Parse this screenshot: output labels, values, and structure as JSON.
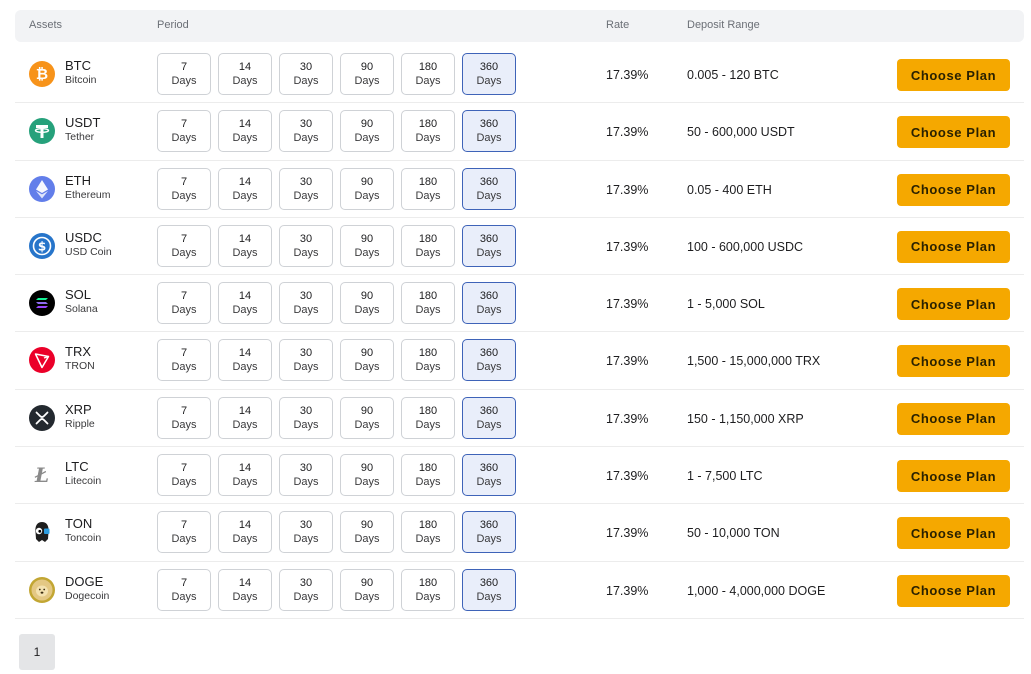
{
  "header": {
    "assets": "Assets",
    "period": "Period",
    "rate": "Rate",
    "deposit_range": "Deposit Range"
  },
  "period_unit": "Days",
  "periods": [
    "7",
    "14",
    "30",
    "90",
    "180",
    "360"
  ],
  "selected_period": "360",
  "choose_label": "Choose Plan",
  "rows": [
    {
      "symbol": "BTC",
      "name": "Bitcoin",
      "rate": "17.39%",
      "range": "0.005 - 120 BTC",
      "icon": "bitcoin-icon",
      "color": "#f7931a"
    },
    {
      "symbol": "USDT",
      "name": "Tether",
      "rate": "17.39%",
      "range": "50 - 600,000 USDT",
      "icon": "tether-icon",
      "color": "#26a17b"
    },
    {
      "symbol": "ETH",
      "name": "Ethereum",
      "rate": "17.39%",
      "range": "0.05 - 400 ETH",
      "icon": "ethereum-icon",
      "color": "#627eea"
    },
    {
      "symbol": "USDC",
      "name": "USD Coin",
      "rate": "17.39%",
      "range": "100 - 600,000 USDC",
      "icon": "usdc-icon",
      "color": "#2775ca"
    },
    {
      "symbol": "SOL",
      "name": "Solana",
      "rate": "17.39%",
      "range": "1 - 5,000 SOL",
      "icon": "solana-icon",
      "color": "#000000"
    },
    {
      "symbol": "TRX",
      "name": "TRON",
      "rate": "17.39%",
      "range": "1,500 - 15,000,000 TRX",
      "icon": "tron-icon",
      "color": "#eb0029"
    },
    {
      "symbol": "XRP",
      "name": "Ripple",
      "rate": "17.39%",
      "range": "150 - 1,150,000 XRP",
      "icon": "xrp-icon",
      "color": "#23292f"
    },
    {
      "symbol": "LTC",
      "name": "Litecoin",
      "rate": "17.39%",
      "range": "1 - 7,500 LTC",
      "icon": "litecoin-icon",
      "color": "#8a8a8a"
    },
    {
      "symbol": "TON",
      "name": "Toncoin",
      "rate": "17.39%",
      "range": "50 - 10,000 TON",
      "icon": "toncoin-icon",
      "color": "#1e1e1e"
    },
    {
      "symbol": "DOGE",
      "name": "Dogecoin",
      "rate": "17.39%",
      "range": "1,000 - 4,000,000 DOGE",
      "icon": "dogecoin-icon",
      "color": "#c2a633"
    }
  ],
  "pagination": {
    "current_page": "1"
  }
}
